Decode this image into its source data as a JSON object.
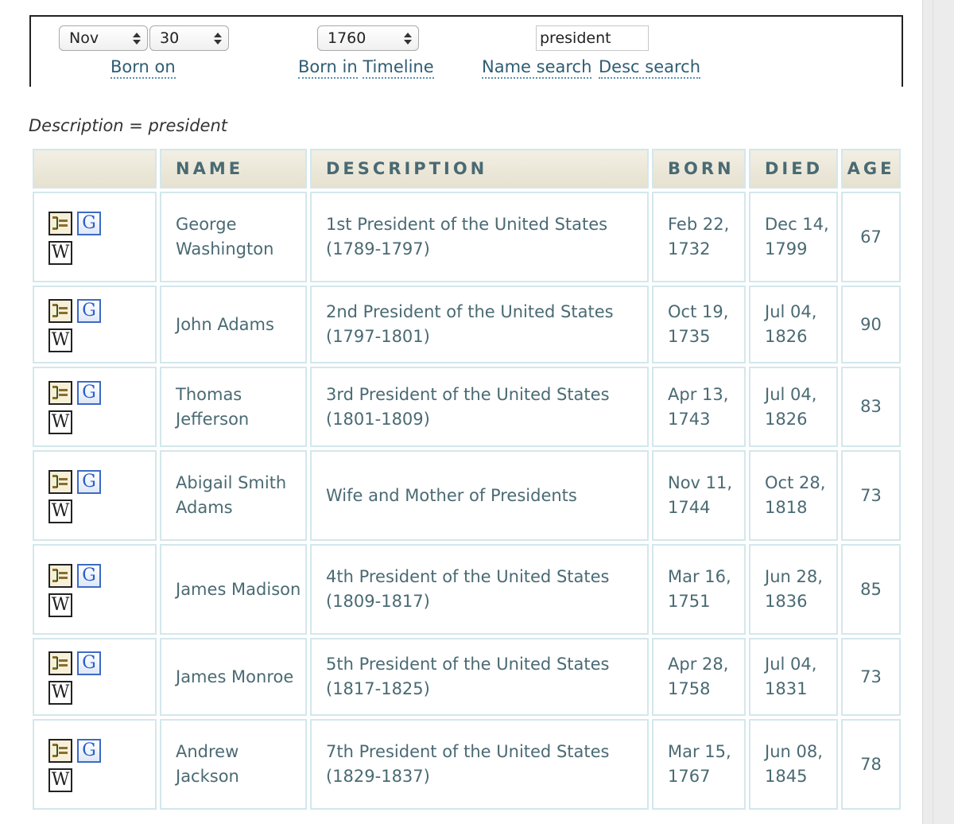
{
  "controls": {
    "month": "Nov",
    "day": "30",
    "year": "1760",
    "search_value": "president",
    "born_on": "Born on",
    "born_in_timeline_1": "Born in",
    "born_in_timeline_2": "Timeline",
    "name_search": "Name search",
    "desc_search": "Desc search"
  },
  "description_line": "Description = president",
  "table": {
    "headers": {
      "name": "NAME",
      "description": "DESCRIPTION",
      "born": "BORN",
      "died": "DIED",
      "age": "AGE"
    },
    "icons": {
      "tree": "family-tree-icon",
      "google": "G",
      "wikipedia": "W"
    },
    "rows": [
      {
        "name": "George Washington",
        "description": "1st President of the United States (1789-1797)",
        "born": "Feb 22, 1732",
        "died": "Dec 14, 1799",
        "age": "67"
      },
      {
        "name": "John Adams",
        "description": "2nd President of the United States (1797-1801)",
        "born": "Oct 19, 1735",
        "died": "Jul 04, 1826",
        "age": "90"
      },
      {
        "name": "Thomas Jefferson",
        "description": "3rd President of the United States (1801-1809)",
        "born": "Apr 13, 1743",
        "died": "Jul 04, 1826",
        "age": "83"
      },
      {
        "name": "Abigail Smith Adams",
        "description": "Wife and Mother of Presidents",
        "born": "Nov 11, 1744",
        "died": "Oct 28, 1818",
        "age": "73"
      },
      {
        "name": "James Madison",
        "description": "4th President of the United States (1809-1817)",
        "born": "Mar 16, 1751",
        "died": "Jun 28, 1836",
        "age": "85"
      },
      {
        "name": "James Monroe",
        "description": "5th President of the United States (1817-1825)",
        "born": "Apr 28, 1758",
        "died": "Jul 04, 1831",
        "age": "73"
      },
      {
        "name": "Andrew Jackson",
        "description": "7th President of the United States (1829-1837)",
        "born": "Mar 15, 1767",
        "died": "Jun 08, 1845",
        "age": "78"
      }
    ]
  }
}
